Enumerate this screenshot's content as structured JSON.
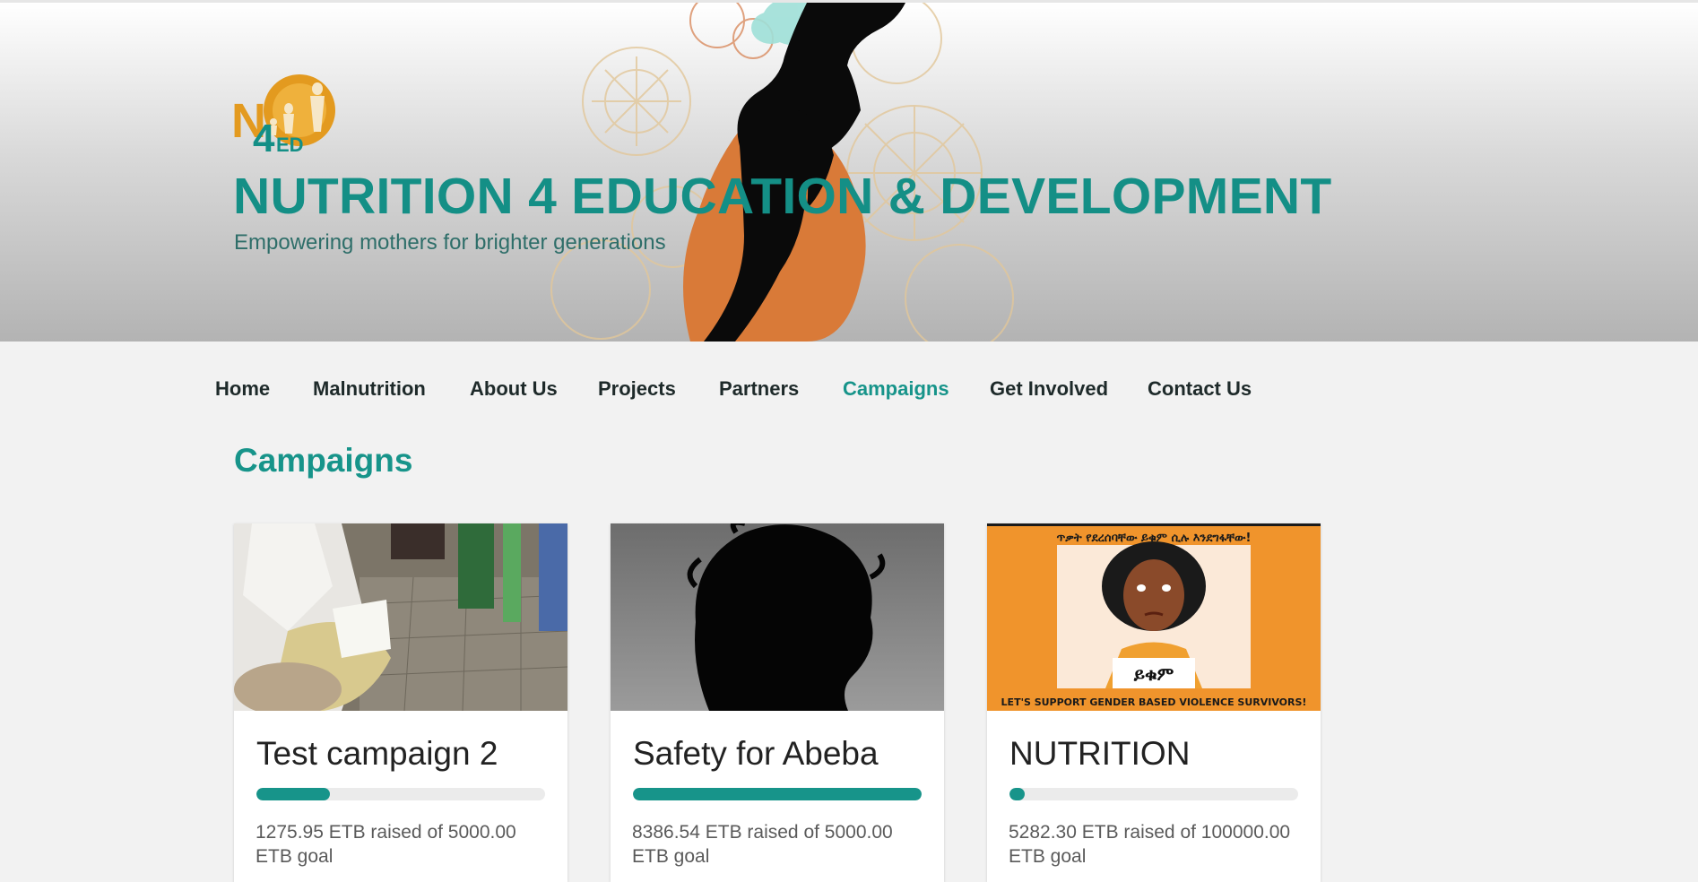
{
  "site": {
    "title": "NUTRITION 4 EDUCATION & DEVELOPMENT",
    "tagline": "Empowering mothers for brighter generations",
    "logo_text": "N4ED"
  },
  "colors": {
    "brand": "#17948a",
    "logo_orange": "#e39a1f",
    "text_dark": "#1e2a2a"
  },
  "nav": {
    "items": [
      {
        "label": "Home"
      },
      {
        "label": "Malnutrition"
      },
      {
        "label": "About Us"
      },
      {
        "label": "Projects"
      },
      {
        "label": "Partners"
      },
      {
        "label": "Campaigns",
        "active": true
      },
      {
        "label": "Get Involved"
      },
      {
        "label": "Contact Us"
      }
    ]
  },
  "page": {
    "title": "Campaigns"
  },
  "campaigns": [
    {
      "title": "Test campaign 2",
      "progress_percent": 25.5,
      "raised_text": "1275.95 ETB raised of 5000.00 ETB goal",
      "image": "photo of women seated reading leaflets"
    },
    {
      "title": "Safety for Abeba",
      "progress_percent": 100,
      "raised_text": "8386.54 ETB raised of 5000.00 ETB goal",
      "image": "black silhouette of a head on grey background"
    },
    {
      "title": "NUTRITION",
      "progress_percent": 5.3,
      "raised_text": "5282.30 ETB raised of 100000.00 ETB goal",
      "image": "illustrated poster of a woman holding a sign",
      "poster": {
        "header": "ጥቃት የደረሰባቸው ይቁም ሲሉ እንደግፋቸው!",
        "sign": "ይቁም",
        "footer": "LET'S SUPPORT GENDER BASED VIOLENCE SURVIVORS!"
      }
    }
  ]
}
